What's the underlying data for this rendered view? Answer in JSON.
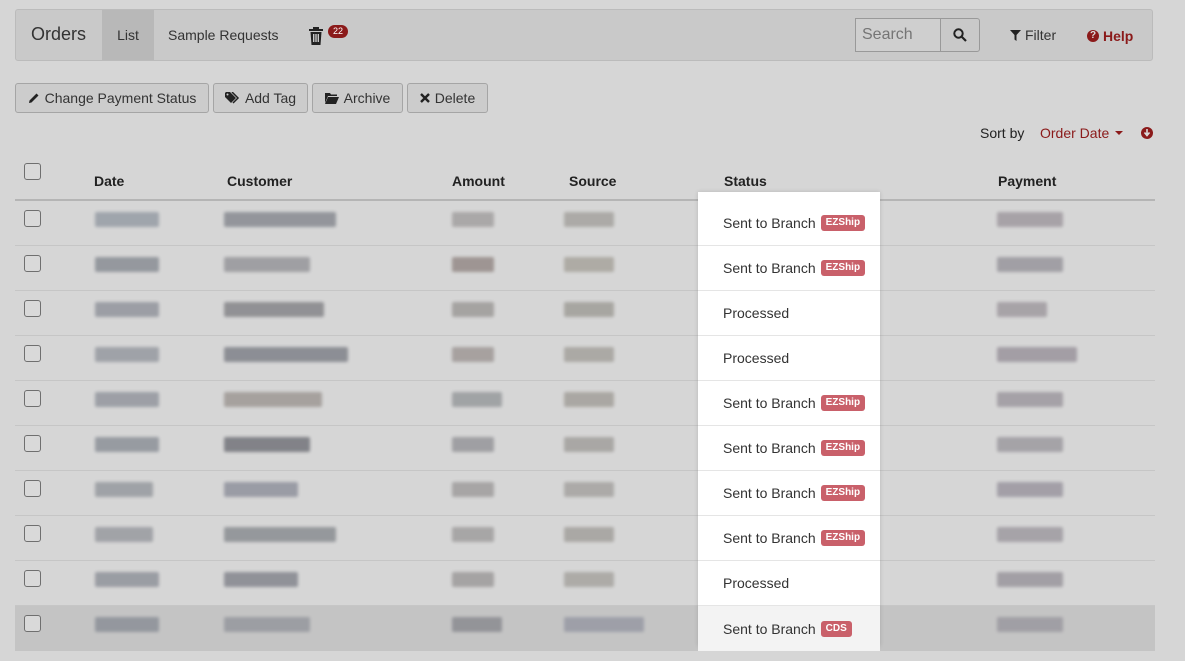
{
  "navbar": {
    "brand": "Orders",
    "tabs": [
      "List",
      "Sample Requests"
    ],
    "trash_count": "22",
    "search_placeholder": "Search",
    "filter_label": "Filter",
    "help_label": "Help"
  },
  "toolbar": {
    "change_payment_label": "Change Payment Status",
    "add_tag_label": "Add Tag",
    "archive_label": "Archive",
    "delete_label": "Delete"
  },
  "sort": {
    "label": "Sort by",
    "value": "Order Date"
  },
  "table": {
    "columns": [
      "Date",
      "Customer",
      "Amount",
      "Source",
      "Status",
      "Payment"
    ],
    "rows": [
      {
        "status": "Sent to Branch",
        "tag": "EZShip"
      },
      {
        "status": "Sent to Branch",
        "tag": "EZShip"
      },
      {
        "status": "Processed",
        "tag": ""
      },
      {
        "status": "Processed",
        "tag": ""
      },
      {
        "status": "Sent to Branch",
        "tag": "EZShip"
      },
      {
        "status": "Sent to Branch",
        "tag": "EZShip"
      },
      {
        "status": "Sent to Branch",
        "tag": "EZShip"
      },
      {
        "status": "Sent to Branch",
        "tag": "EZShip"
      },
      {
        "status": "Processed",
        "tag": ""
      },
      {
        "status": "Sent to Branch",
        "tag": "CDS"
      }
    ]
  },
  "colors": {
    "accent": "#8b1a1a",
    "tag": "#c9606a"
  }
}
